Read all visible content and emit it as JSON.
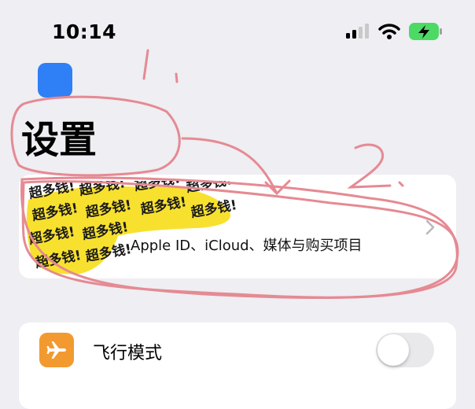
{
  "status_bar": {
    "time": "10:14"
  },
  "page": {
    "title": "设置"
  },
  "account": {
    "label": "Apple ID、iCloud、媒体与购买项目",
    "sticker_text": "超多钱!"
  },
  "settings": {
    "rows": [
      {
        "label": "飞行模式",
        "icon": "airplane-icon",
        "toggle_on": false
      }
    ]
  },
  "annotations": {
    "mark_1": "1.",
    "mark_2": "2."
  },
  "colors": {
    "airplane": "#f29a30",
    "highlight": "#f8e12e",
    "annotation": "#e58a93",
    "next_icon": "#2f7ff6"
  }
}
